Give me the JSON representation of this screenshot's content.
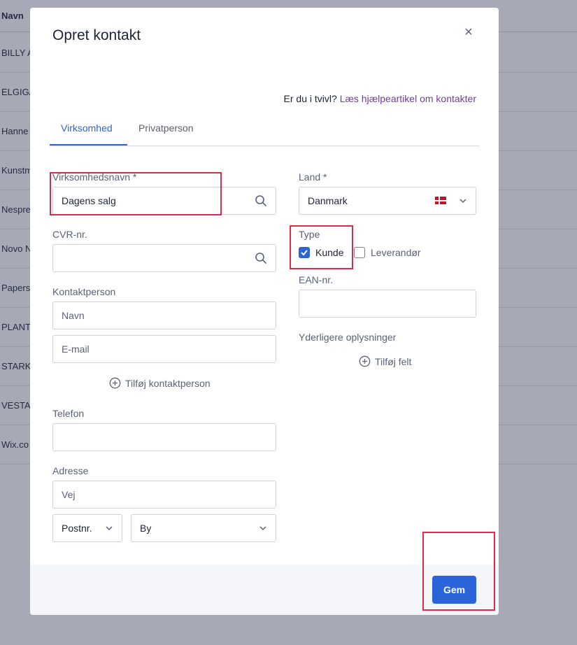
{
  "background": {
    "column_header": "Navn",
    "rows": [
      "BILLY A",
      "ELGIGA",
      "Hanne",
      "Kunstm",
      "Nespre",
      "Novo N",
      "Papers",
      "PLANT",
      "STARK",
      "VESTAS",
      "Wix.co"
    ]
  },
  "modal": {
    "title": "Opret kontakt",
    "close_symbol": "×",
    "help_prefix": "Er du i tvivl?",
    "help_link": "Læs hjælpeartikel om kontakter",
    "tabs": [
      "Virksomhed",
      "Privatperson"
    ],
    "company_name_label": "Virksomhedsnavn *",
    "company_name_value": "Dagens salg",
    "cvr_label": "CVR-nr.",
    "contact_person_label": "Kontaktperson",
    "name_placeholder": "Navn",
    "email_placeholder": "E-mail",
    "add_contact_person": "Tilføj kontaktperson",
    "phone_label": "Telefon",
    "address_label": "Adresse",
    "road_placeholder": "Vej",
    "postal_placeholder": "Postnr.",
    "city_placeholder": "By",
    "country_label": "Land *",
    "country_value": "Danmark",
    "type_label": "Type",
    "type_customer": "Kunde",
    "type_customer_checked": true,
    "type_supplier": "Leverandør",
    "type_supplier_checked": false,
    "ean_label": "EAN-nr.",
    "extra_info_label": "Yderligere oplysninger",
    "add_field": "Tilføj felt",
    "save_button": "Gem"
  },
  "colors": {
    "accent": "#2b63d9",
    "highlight": "#e02a4a",
    "link": "#6b3fa0"
  }
}
